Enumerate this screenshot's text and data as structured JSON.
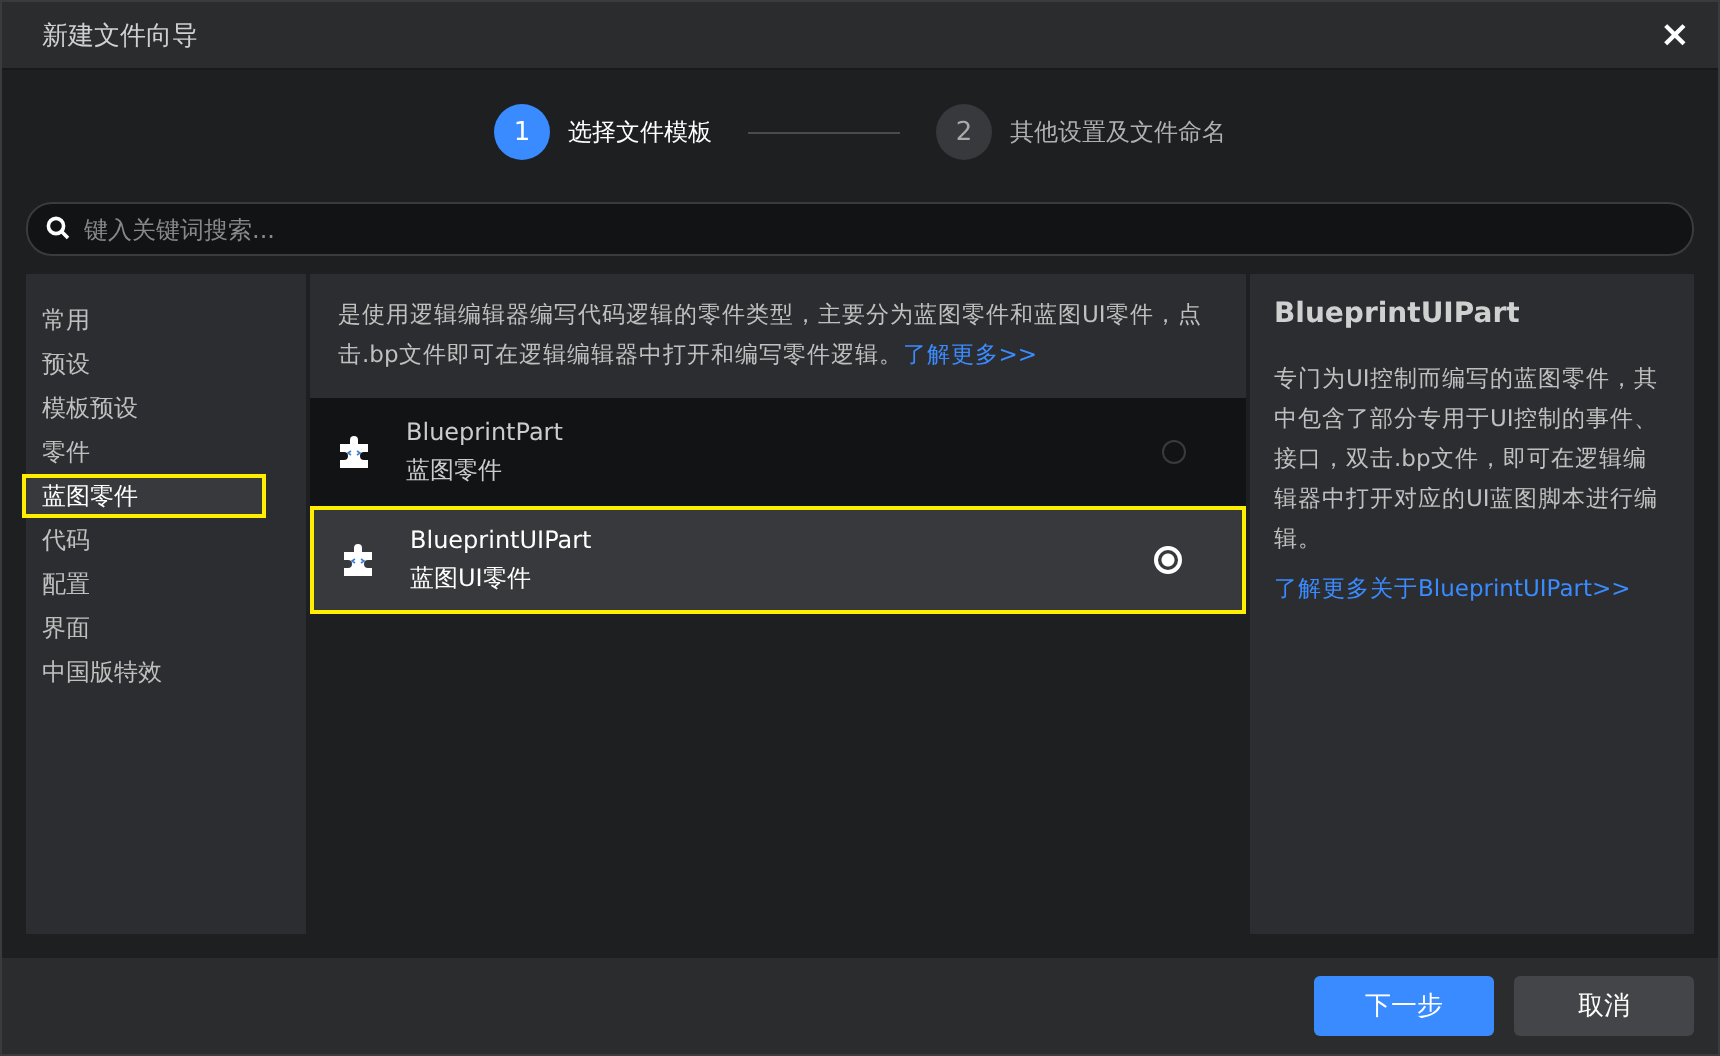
{
  "window": {
    "title": "新建文件向导",
    "close": "×"
  },
  "steps": [
    {
      "number": "1",
      "label": "选择文件模板",
      "selected": true
    },
    {
      "number": "2",
      "label": "其他设置及文件命名",
      "selected": false
    }
  ],
  "search": {
    "placeholder": "键入关键词搜索..."
  },
  "sidebar": {
    "items": [
      {
        "label": "常用",
        "selected": false
      },
      {
        "label": "预设",
        "selected": false
      },
      {
        "label": "模板预设",
        "selected": false
      },
      {
        "label": "零件",
        "selected": false
      },
      {
        "label": "蓝图零件",
        "selected": true
      },
      {
        "label": "代码",
        "selected": false
      },
      {
        "label": "配置",
        "selected": false
      },
      {
        "label": "界面",
        "selected": false
      },
      {
        "label": "中国版特效",
        "selected": false
      }
    ]
  },
  "category": {
    "description": "是使用逻辑编辑器编写代码逻辑的零件类型，主要分为蓝图零件和蓝图UI零件，点击.bp文件即可在逻辑编辑器中打开和编写零件逻辑。",
    "link": "了解更多>>"
  },
  "templates": [
    {
      "name": "BlueprintPart",
      "subtitle": "蓝图零件",
      "selected": false
    },
    {
      "name": "BlueprintUIPart",
      "subtitle": "蓝图UI零件",
      "selected": true
    }
  ],
  "details": {
    "title": "BlueprintUIPart",
    "description": "专门为UI控制而编写的蓝图零件，其中包含了部分专用于UI控制的事件、接口，双击.bp文件，即可在逻辑编辑器中打开对应的UI蓝图脚本进行编辑。",
    "link": "了解更多关于BlueprintUIPart>>"
  },
  "buttons": [
    {
      "label": "下一步",
      "kind": "primary"
    },
    {
      "label": "取消",
      "kind": "secondary"
    }
  ]
}
